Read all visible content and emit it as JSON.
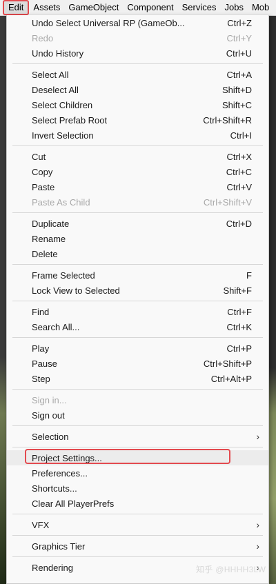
{
  "menubar": {
    "items": [
      "Edit",
      "Assets",
      "GameObject",
      "Component",
      "Services",
      "Jobs",
      "Mob"
    ]
  },
  "menu": {
    "undo": {
      "label": "Undo Select Universal RP (GameOb...",
      "shortcut": "Ctrl+Z"
    },
    "redo": {
      "label": "Redo",
      "shortcut": "Ctrl+Y"
    },
    "undo_history": {
      "label": "Undo History",
      "shortcut": "Ctrl+U"
    },
    "select_all": {
      "label": "Select All",
      "shortcut": "Ctrl+A"
    },
    "deselect_all": {
      "label": "Deselect All",
      "shortcut": "Shift+D"
    },
    "select_children": {
      "label": "Select Children",
      "shortcut": "Shift+C"
    },
    "select_prefab_root": {
      "label": "Select Prefab Root",
      "shortcut": "Ctrl+Shift+R"
    },
    "invert_selection": {
      "label": "Invert Selection",
      "shortcut": "Ctrl+I"
    },
    "cut": {
      "label": "Cut",
      "shortcut": "Ctrl+X"
    },
    "copy": {
      "label": "Copy",
      "shortcut": "Ctrl+C"
    },
    "paste": {
      "label": "Paste",
      "shortcut": "Ctrl+V"
    },
    "paste_as_child": {
      "label": "Paste As Child",
      "shortcut": "Ctrl+Shift+V"
    },
    "duplicate": {
      "label": "Duplicate",
      "shortcut": "Ctrl+D"
    },
    "rename": {
      "label": "Rename"
    },
    "delete": {
      "label": "Delete"
    },
    "frame_selected": {
      "label": "Frame Selected",
      "shortcut": "F"
    },
    "lock_view": {
      "label": "Lock View to Selected",
      "shortcut": "Shift+F"
    },
    "find": {
      "label": "Find",
      "shortcut": "Ctrl+F"
    },
    "search_all": {
      "label": "Search All...",
      "shortcut": "Ctrl+K"
    },
    "play": {
      "label": "Play",
      "shortcut": "Ctrl+P"
    },
    "pause": {
      "label": "Pause",
      "shortcut": "Ctrl+Shift+P"
    },
    "step": {
      "label": "Step",
      "shortcut": "Ctrl+Alt+P"
    },
    "sign_in": {
      "label": "Sign in..."
    },
    "sign_out": {
      "label": "Sign out"
    },
    "selection": {
      "label": "Selection"
    },
    "project_settings": {
      "label": "Project Settings..."
    },
    "preferences": {
      "label": "Preferences..."
    },
    "shortcuts": {
      "label": "Shortcuts..."
    },
    "clear_playerprefs": {
      "label": "Clear All PlayerPrefs"
    },
    "vfx": {
      "label": "VFX"
    },
    "graphics_tier": {
      "label": "Graphics Tier"
    },
    "rendering": {
      "label": "Rendering"
    }
  },
  "submenu_arrow": "›",
  "watermark": "知乎 @HHHH3LW",
  "colors": {
    "highlight_outline": "#e34a4f",
    "disabled_text": "#a8a8a8"
  }
}
